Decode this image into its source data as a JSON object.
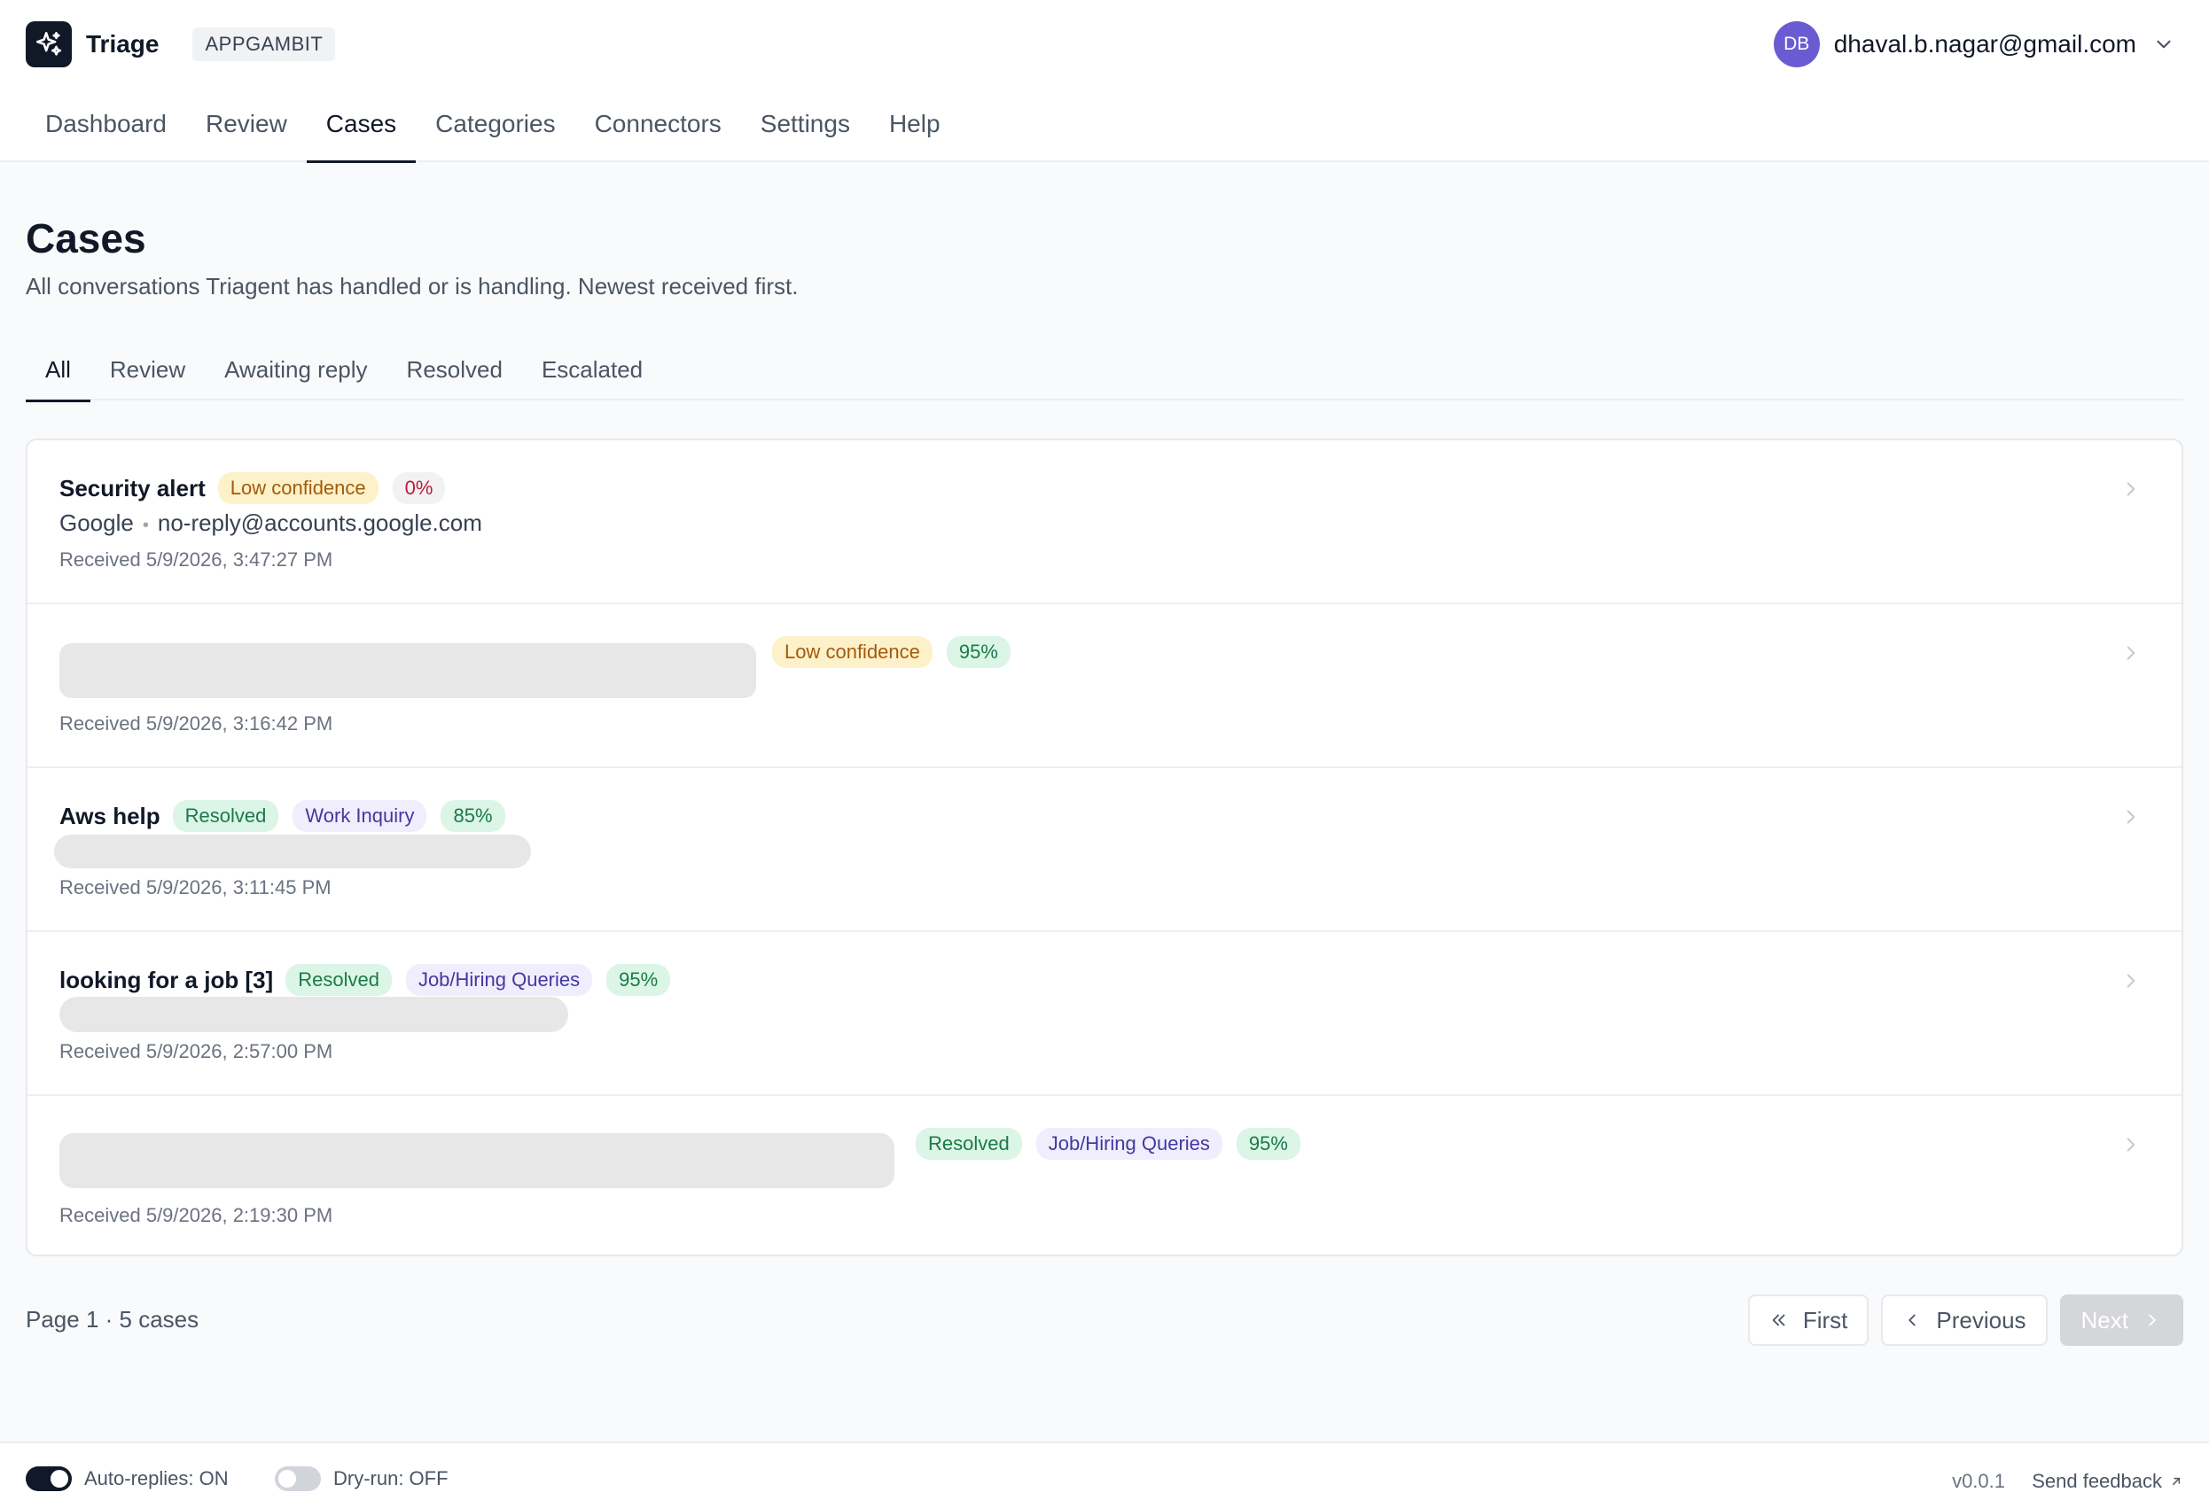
{
  "app": {
    "name": "Triage",
    "org_badge": "APPGAMBIT",
    "user_initials": "DB",
    "user_email": "dhaval.b.nagar@gmail.com"
  },
  "nav": {
    "items": [
      "Dashboard",
      "Review",
      "Cases",
      "Categories",
      "Connectors",
      "Settings",
      "Help"
    ],
    "active": "Cases"
  },
  "page": {
    "title": "Cases",
    "subtitle": "All conversations Triagent has handled or is handling. Newest received first."
  },
  "filters": {
    "tabs": [
      "All",
      "Review",
      "Awaiting reply",
      "Resolved",
      "Escalated"
    ],
    "active": "All"
  },
  "cases": [
    {
      "title": "Security alert",
      "badges": [
        {
          "text": "Low confidence",
          "kind": "low"
        },
        {
          "text": "0%",
          "kind": "pct-red"
        }
      ],
      "sender_name": "Google",
      "sender_email": "no-reply@accounts.google.com",
      "received": "Received 5/9/2026, 3:47:27 PM"
    },
    {
      "title": "",
      "badges": [
        {
          "text": "Low confidence",
          "kind": "low"
        },
        {
          "text": "95%",
          "kind": "pct-green"
        }
      ],
      "received": "Received 5/9/2026, 3:16:42 PM"
    },
    {
      "title": "Aws help",
      "badges": [
        {
          "text": "Resolved",
          "kind": "resolved"
        },
        {
          "text": "Work Inquiry",
          "kind": "cat"
        },
        {
          "text": "85%",
          "kind": "pct-green"
        }
      ],
      "received": "Received 5/9/2026, 3:11:45 PM"
    },
    {
      "title": "looking for a job [3]",
      "badges": [
        {
          "text": "Resolved",
          "kind": "resolved"
        },
        {
          "text": "Job/Hiring Queries",
          "kind": "cat"
        },
        {
          "text": "95%",
          "kind": "pct-green"
        }
      ],
      "received": "Received 5/9/2026, 2:57:00 PM"
    },
    {
      "title": "",
      "badges": [
        {
          "text": "Resolved",
          "kind": "resolved"
        },
        {
          "text": "Job/Hiring Queries",
          "kind": "cat"
        },
        {
          "text": "95%",
          "kind": "pct-green"
        }
      ],
      "received": "Received 5/9/2026, 2:19:30 PM"
    }
  ],
  "pagination": {
    "info": "Page 1 · 5 cases",
    "first": "First",
    "previous": "Previous",
    "next": "Next"
  },
  "footer": {
    "auto_replies": "Auto-replies: ON",
    "auto_replies_on": true,
    "dry_run": "Dry-run: OFF",
    "dry_run_on": false,
    "version": "v0.0.1",
    "feedback": "Send feedback"
  },
  "colors": {
    "accent": "#111827",
    "avatar": "#6b5bd2",
    "low_confidence_bg": "#fdf1c9",
    "resolved_bg": "#dbf5e7",
    "category_bg": "#f0eefd",
    "danger_text": "#c21a3b"
  },
  "icons": {
    "logo": "sparkle-icon",
    "account_menu": "chevron-down-icon",
    "row": "chevron-right-icon",
    "first": "double-chevron-left-icon",
    "previous": "chevron-left-icon",
    "next": "chevron-right-icon",
    "feedback": "arrow-up-right-icon"
  }
}
